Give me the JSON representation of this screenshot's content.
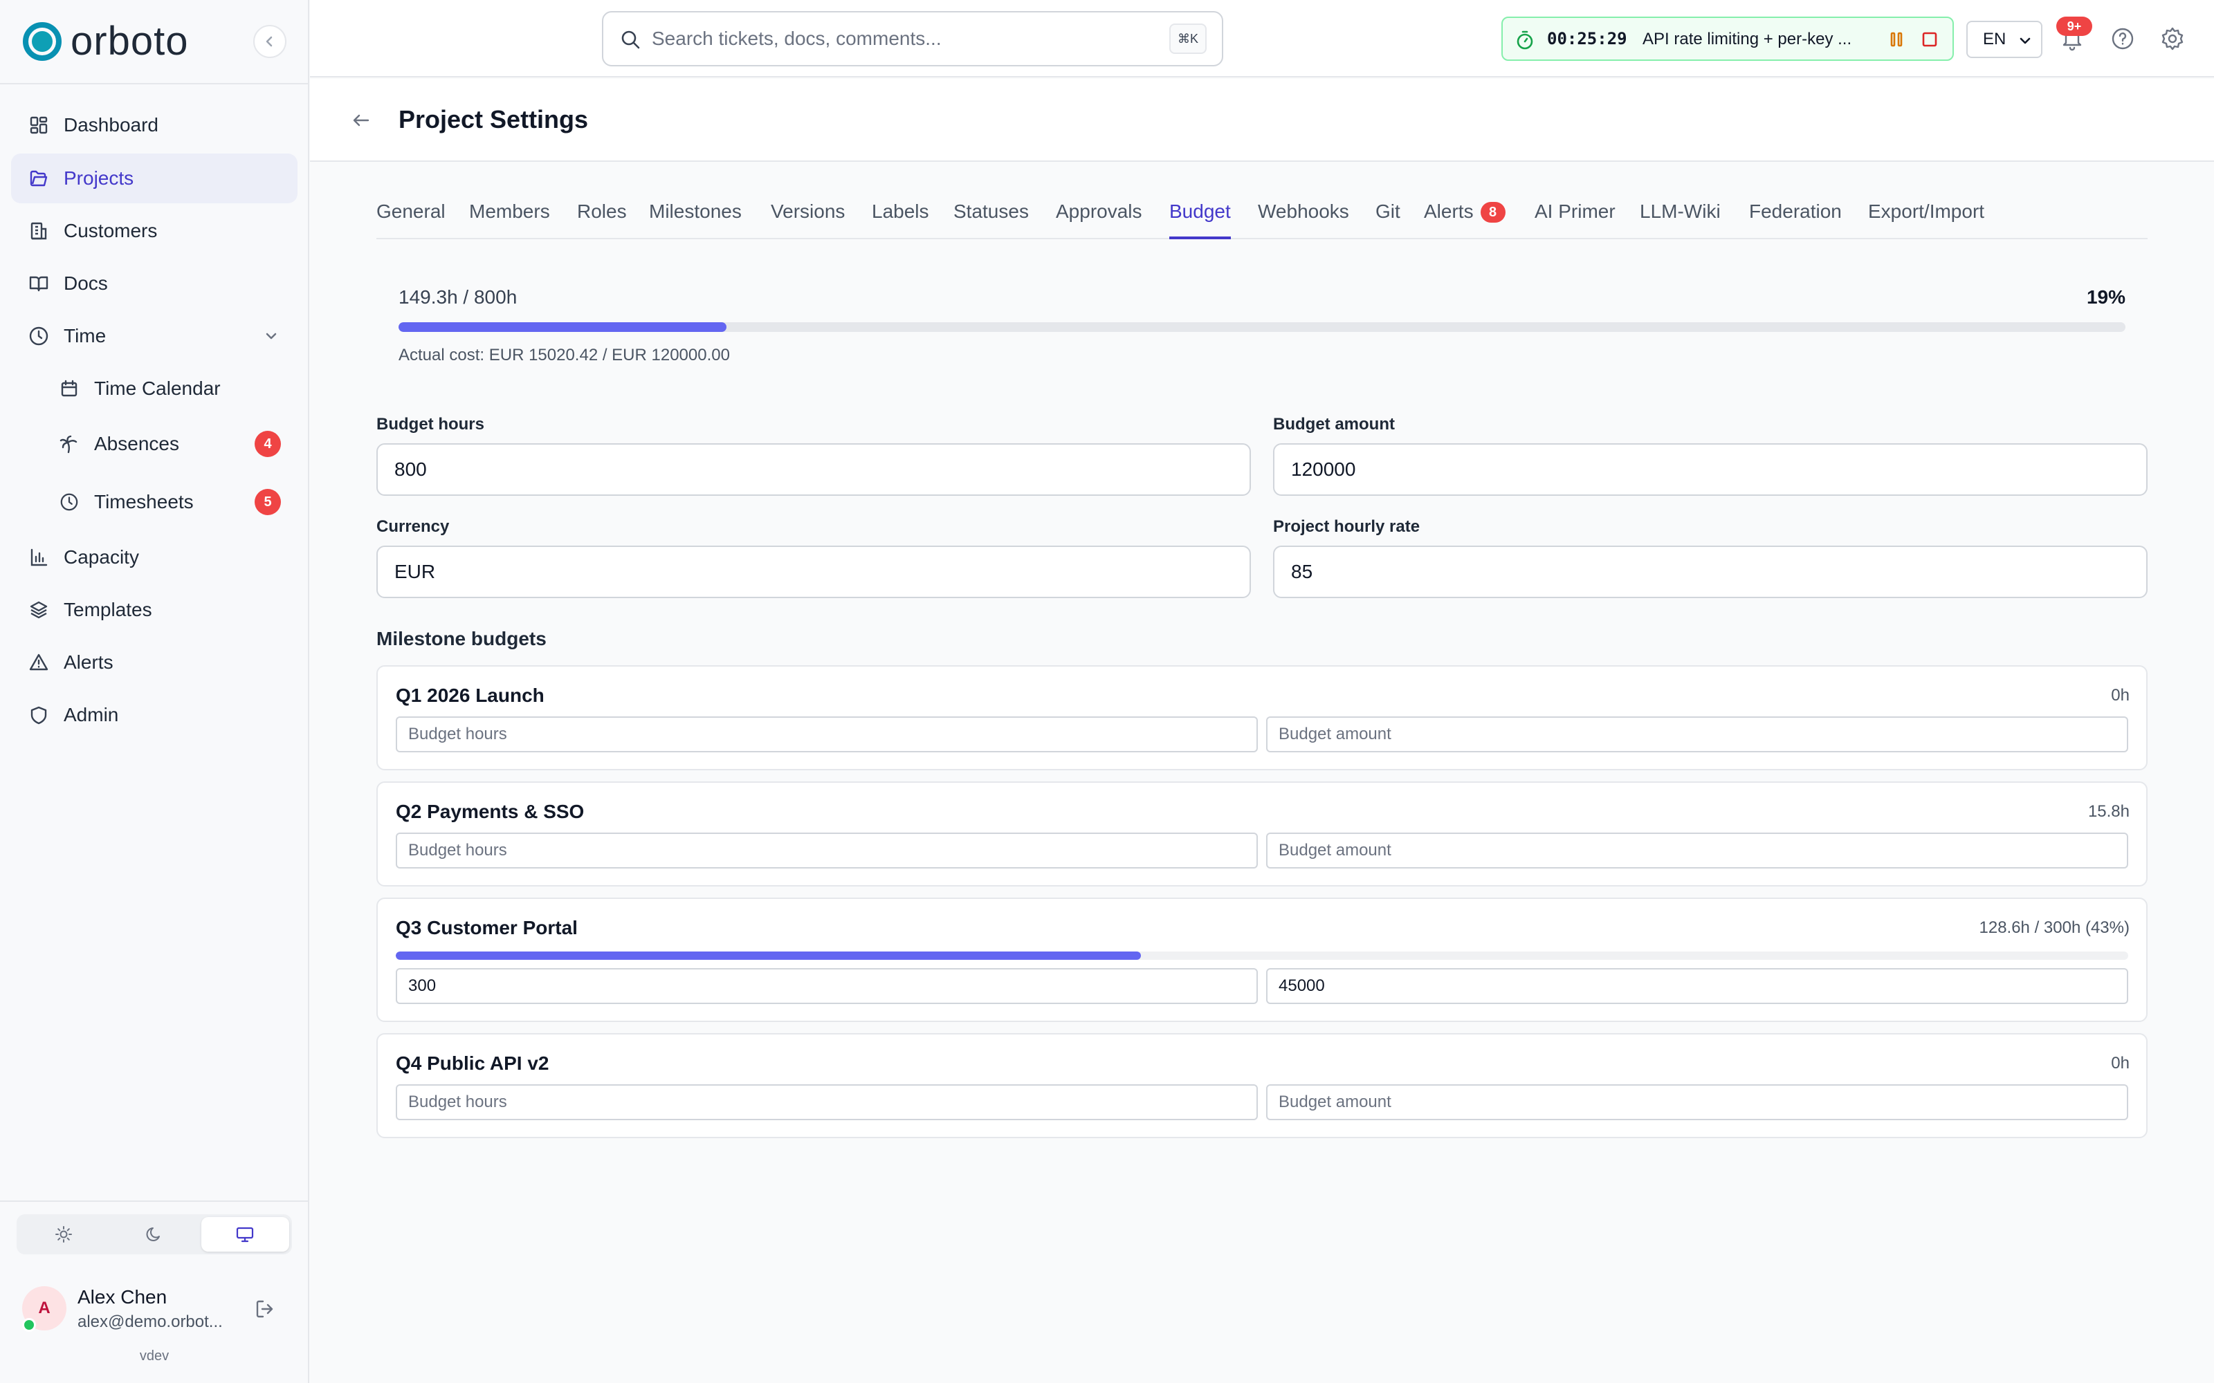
{
  "app": {
    "name": "orboto",
    "version": "vdev"
  },
  "sidebar": {
    "items": [
      {
        "label": "Dashboard",
        "icon": "dashboard-icon"
      },
      {
        "label": "Projects",
        "icon": "folder-icon",
        "active": true
      },
      {
        "label": "Customers",
        "icon": "building-icon"
      },
      {
        "label": "Docs",
        "icon": "book-icon"
      },
      {
        "label": "Time",
        "icon": "clock-icon",
        "expanded": true
      },
      {
        "label": "Time Calendar",
        "icon": "calendar-icon"
      },
      {
        "label": "Absences",
        "icon": "palm-tree-icon",
        "badge": "4"
      },
      {
        "label": "Timesheets",
        "icon": "clock-icon",
        "badge": "5"
      },
      {
        "label": "Capacity",
        "icon": "bar-chart-icon"
      },
      {
        "label": "Templates",
        "icon": "layers-icon"
      },
      {
        "label": "Alerts",
        "icon": "alert-triangle-icon"
      },
      {
        "label": "Admin",
        "icon": "shield-icon"
      }
    ],
    "theme": {
      "options": [
        "light",
        "dark",
        "system"
      ],
      "selected": "system"
    },
    "user": {
      "initial": "A",
      "name": "Alex Chen",
      "email": "alex@demo.orbot..."
    }
  },
  "topbar": {
    "search": {
      "placeholder": "Search tickets, docs, comments...",
      "shortcut": "⌘K"
    },
    "timer": {
      "time": "00:25:29",
      "task": "API rate limiting + per-key ..."
    },
    "language": {
      "selected": "EN",
      "options": [
        "EN"
      ]
    },
    "notifications_badge": "9+"
  },
  "page": {
    "title": "Project Settings"
  },
  "tabs": [
    {
      "label": "General"
    },
    {
      "label": "Members"
    },
    {
      "label": "Roles"
    },
    {
      "label": "Milestones"
    },
    {
      "label": "Versions"
    },
    {
      "label": "Labels"
    },
    {
      "label": "Statuses"
    },
    {
      "label": "Approvals"
    },
    {
      "label": "Budget",
      "active": true
    },
    {
      "label": "Webhooks"
    },
    {
      "label": "Git"
    },
    {
      "label": "Alerts",
      "badge": "8"
    },
    {
      "label": "AI Primer"
    },
    {
      "label": "LLM-Wiki"
    },
    {
      "label": "Federation"
    },
    {
      "label": "Export/Import"
    }
  ],
  "budget": {
    "used_label": "149.3h / 800h",
    "percent_label": "19%",
    "progress": 0.19,
    "cost_label": "Actual cost: EUR 15020.42 / EUR 120000.00",
    "fields": {
      "hours": {
        "label": "Budget hours",
        "value": "800"
      },
      "amount": {
        "label": "Budget amount",
        "value": "120000"
      },
      "currency": {
        "label": "Currency",
        "value": "EUR"
      },
      "rate": {
        "label": "Project hourly rate",
        "value": "85"
      }
    }
  },
  "milestones": {
    "heading": "Milestone budgets",
    "hours_placeholder": "Budget hours",
    "amount_placeholder": "Budget amount",
    "items": [
      {
        "name": "Q1 2026 Launch",
        "info": "0h",
        "hours": "",
        "amount": ""
      },
      {
        "name": "Q2 Payments & SSO",
        "info": "15.8h",
        "hours": "",
        "amount": ""
      },
      {
        "name": "Q3 Customer Portal",
        "info": "128.6h / 300h (43%)",
        "hours": "300",
        "amount": "45000",
        "progress": 0.43
      },
      {
        "name": "Q4 Public API v2",
        "info": "0h",
        "hours": "",
        "amount": ""
      }
    ]
  },
  "colors": {
    "accent": "#4f46e5",
    "progress": "#6366f1",
    "badge": "#ef4444",
    "timer_border": "#86efac",
    "logo": "#0891b2"
  }
}
